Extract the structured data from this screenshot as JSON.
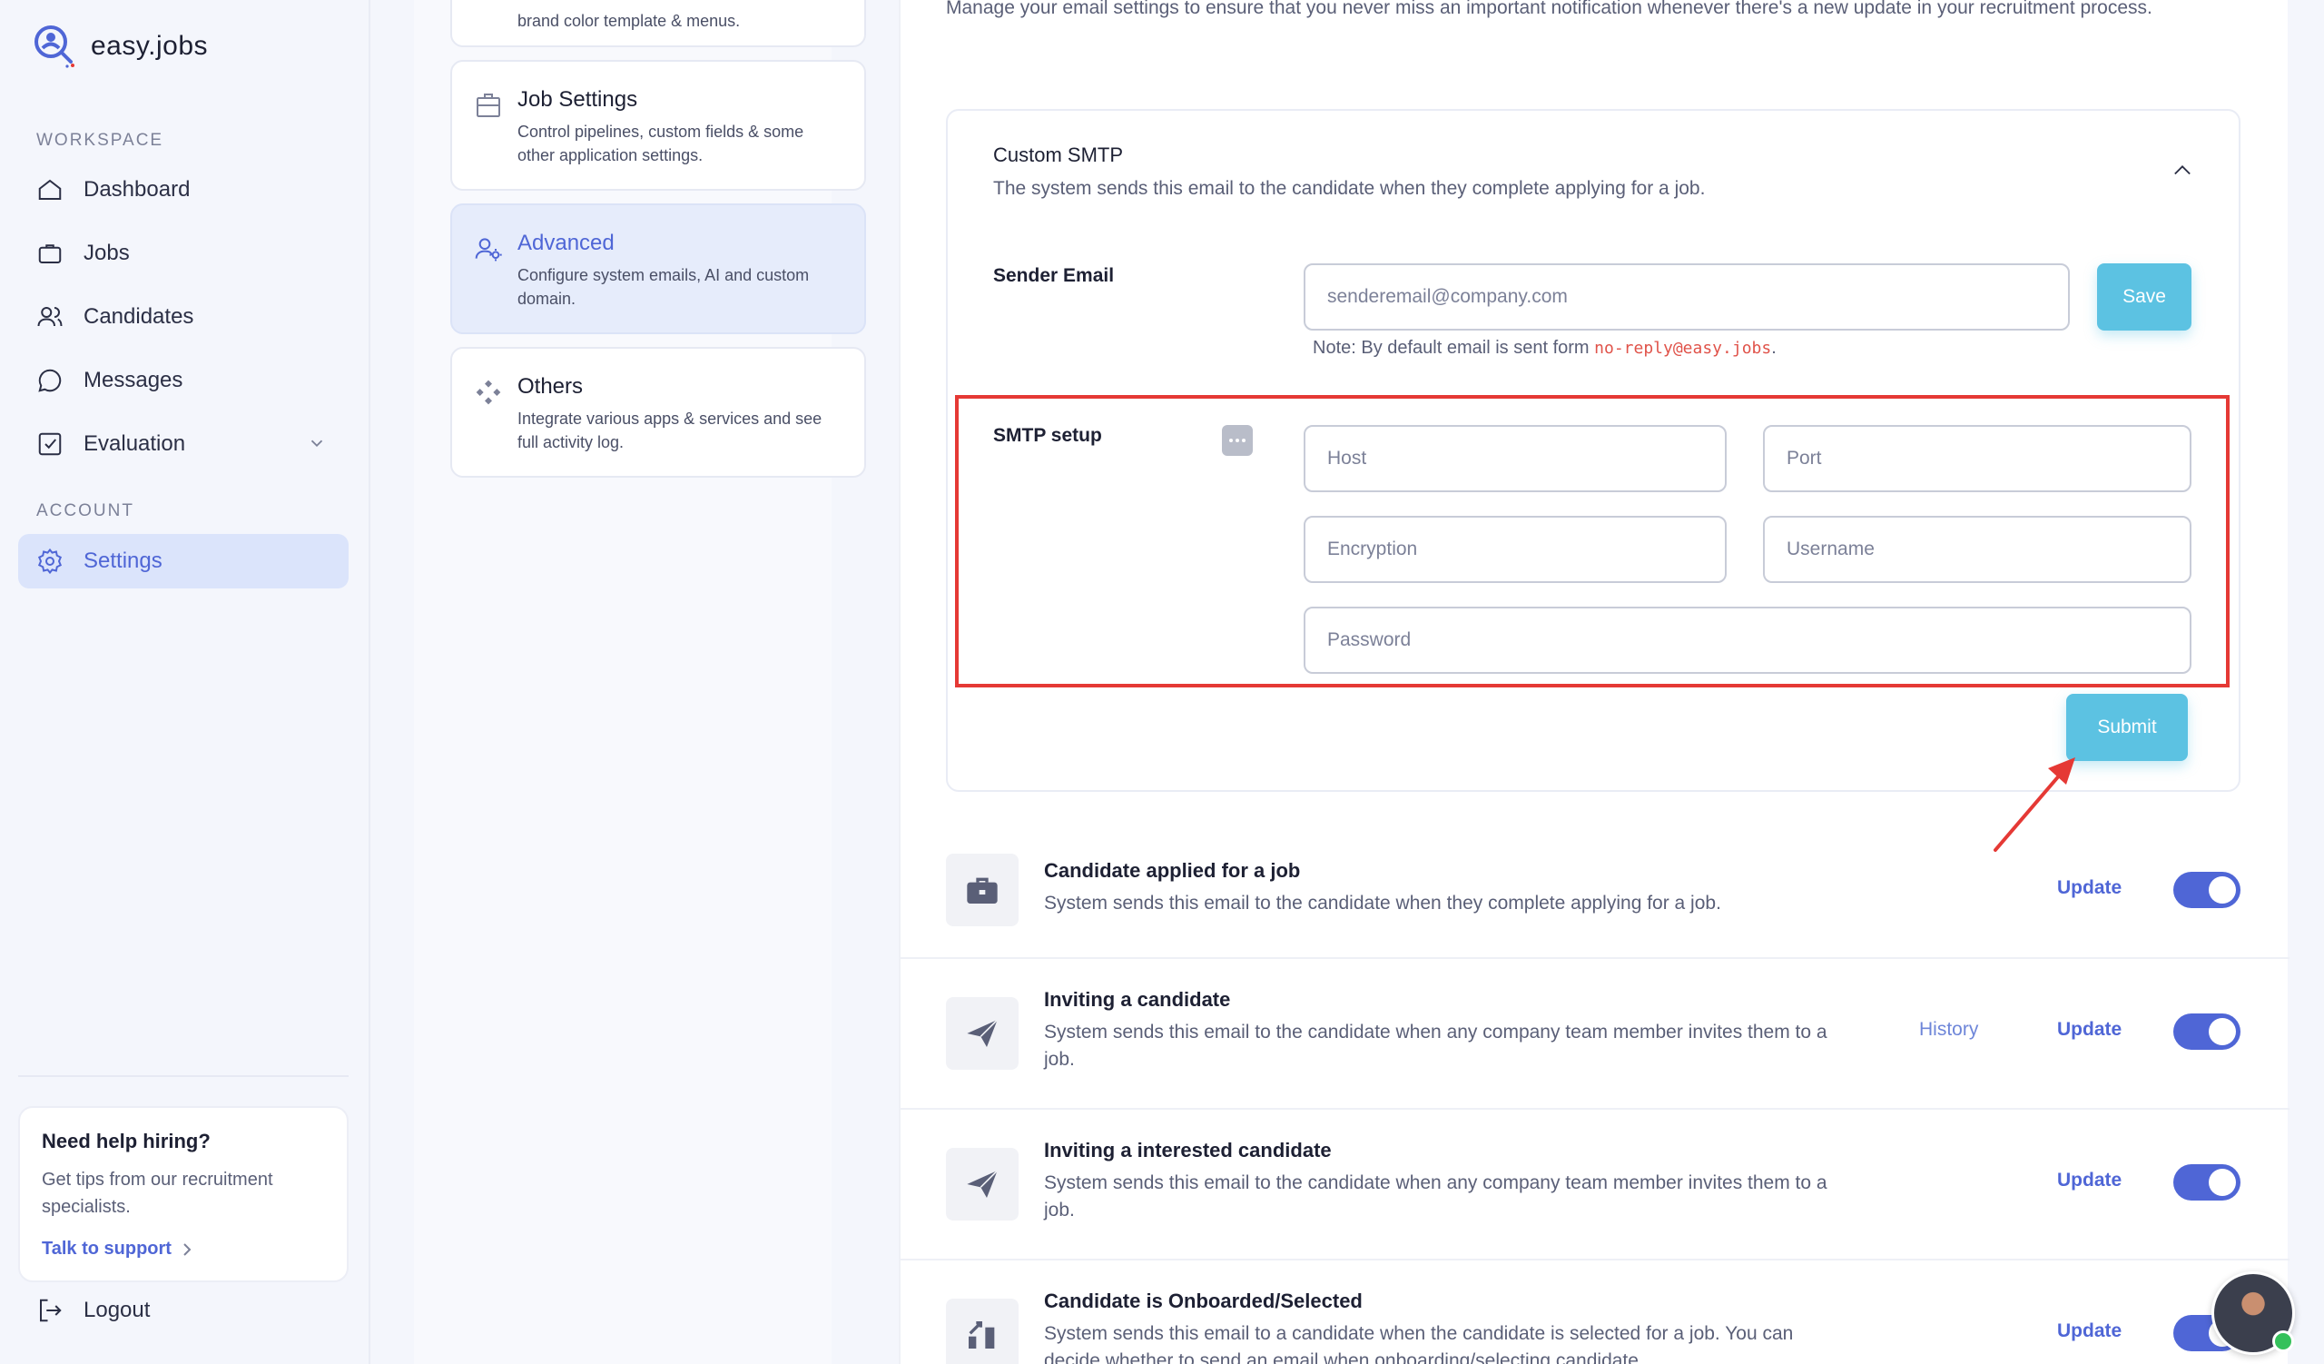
{
  "brand": {
    "name": "easy.jobs"
  },
  "sidebar": {
    "workspace_label": "WORKSPACE",
    "account_label": "ACCOUNT",
    "items": [
      {
        "label": "Dashboard",
        "icon": "home-icon"
      },
      {
        "label": "Jobs",
        "icon": "briefcase-icon"
      },
      {
        "label": "Candidates",
        "icon": "users-icon"
      },
      {
        "label": "Messages",
        "icon": "chat-bubble-icon"
      },
      {
        "label": "Evaluation",
        "icon": "checkbox-icon"
      }
    ],
    "settings_label": "Settings",
    "help": {
      "title": "Need help hiring?",
      "text": "Get tips from our recruitment specialists.",
      "link": "Talk to support"
    },
    "logout": "Logout"
  },
  "settings_menu": [
    {
      "title": "",
      "desc": "brand color template & menus."
    },
    {
      "title": "Job Settings",
      "desc": "Control pipelines, custom fields & some other application settings."
    },
    {
      "title": "Advanced",
      "desc": "Configure system emails, AI and custom domain."
    },
    {
      "title": "Others",
      "desc": "Integrate various apps & services and see full activity log."
    }
  ],
  "intro": "Manage your email settings to ensure that you never miss an important notification whenever there's a new update in your recruitment process.",
  "smtp": {
    "title": "Custom SMTP",
    "subtitle": "The system sends this email to the candidate when they complete applying for a job.",
    "sender_label": "Sender Email",
    "sender_placeholder": "senderemail@company.com",
    "save": "Save",
    "note_prefix": "Note: By default email is sent form ",
    "note_email": "no-reply@easy.jobs",
    "note_suffix": ".",
    "setup_label": "SMTP setup",
    "host": "Host",
    "port": "Port",
    "encryption": "Encryption",
    "username": "Username",
    "password": "Password",
    "submit": "Submit"
  },
  "notifications": [
    {
      "title": "Candidate applied for a job",
      "desc": "System sends this email to the candidate when they complete applying for a job.",
      "update": "Update",
      "history": "",
      "enabled": true
    },
    {
      "title": "Inviting a candidate",
      "desc": "System sends this email to the candidate when any company team member invites them to a job.",
      "update": "Update",
      "history": "History",
      "enabled": true
    },
    {
      "title": "Inviting a interested candidate",
      "desc": "System sends this email to the candidate when any company team member invites them to a job.",
      "update": "Update",
      "history": "",
      "enabled": true
    },
    {
      "title": "Candidate is Onboarded/Selected",
      "desc": "System sends this email to a candidate when the candidate is selected for a job. You can decide whether to send an email when onboarding/selecting candidate.",
      "update": "Update",
      "history": "",
      "enabled": true
    }
  ],
  "colors": {
    "accent": "#4f66d6",
    "button": "#5cc2e2",
    "highlight": "#e53935"
  }
}
